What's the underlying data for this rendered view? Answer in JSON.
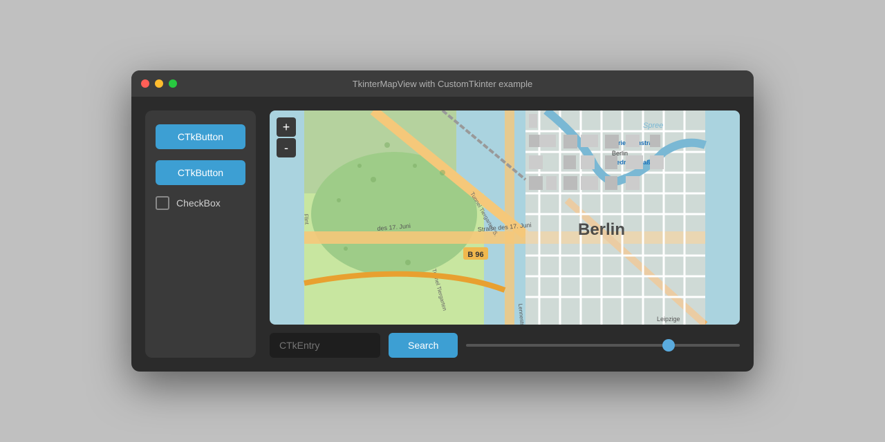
{
  "window": {
    "title": "TkinterMapView with CustomTkinter example"
  },
  "traffic_lights": {
    "close": "close",
    "minimize": "minimize",
    "maximize": "maximize"
  },
  "sidebar": {
    "button1_label": "CTkButton",
    "button2_label": "CTkButton",
    "checkbox_label": "CheckBox"
  },
  "map": {
    "zoom_in_label": "+",
    "zoom_out_label": "-"
  },
  "bottom_bar": {
    "entry_placeholder": "CTkEntry",
    "search_label": "Search",
    "slider_value": 75
  }
}
